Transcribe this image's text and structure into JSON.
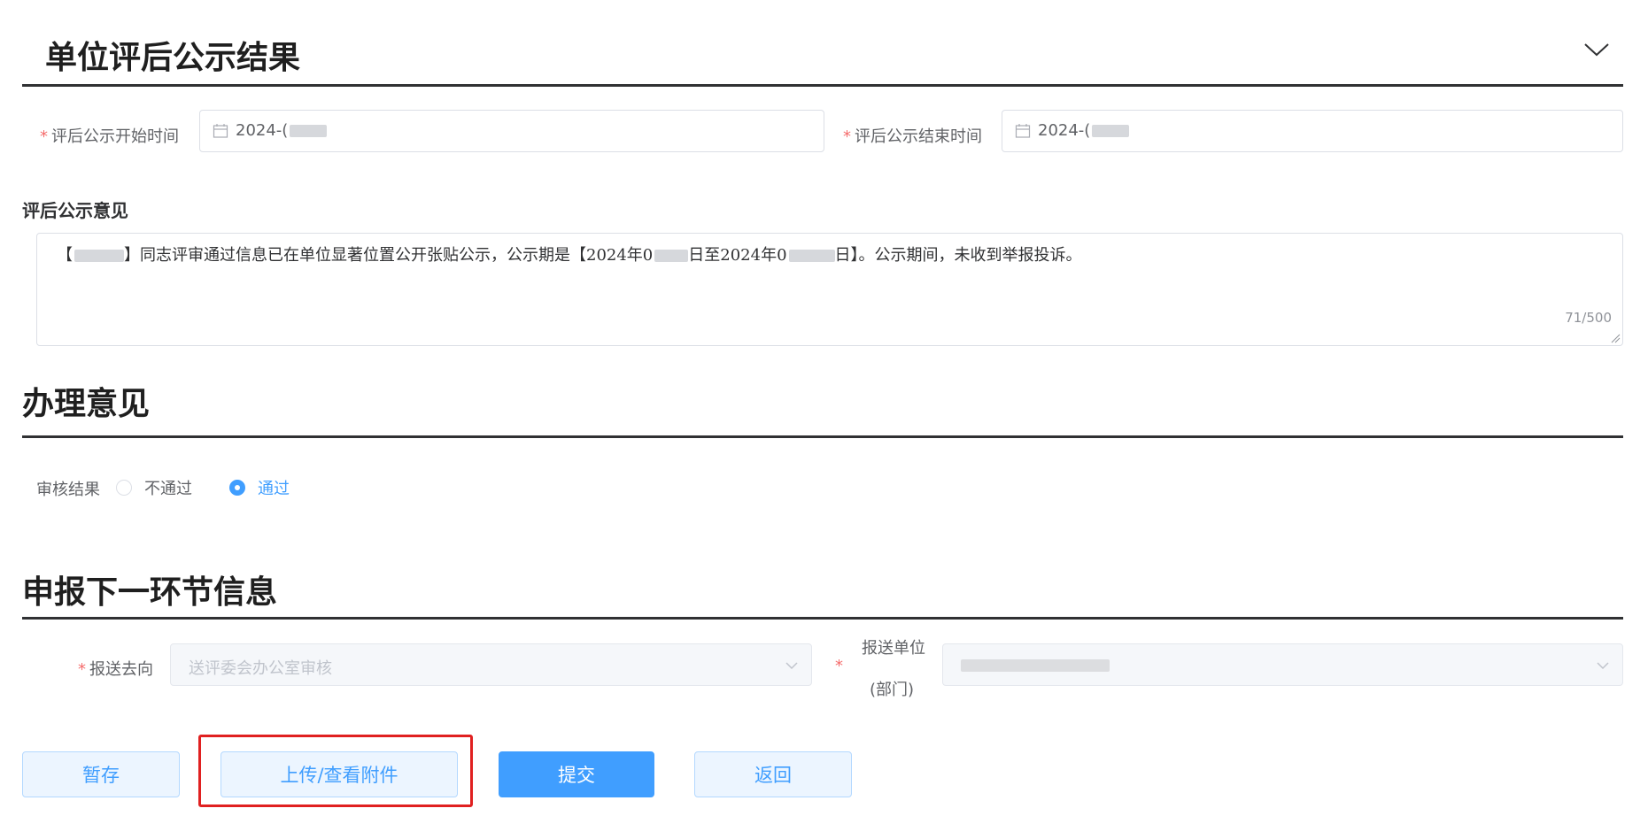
{
  "section1": {
    "title": "单位评后公示结果",
    "start_label": "评后公示开始时间",
    "start_value": "2024-(",
    "end_label": "评后公示结束时间",
    "end_value": "2024-(",
    "opinion_title": "评后公示意见",
    "opinion_text_a": "【",
    "opinion_text_b": "】同志评审通过信息已在单位显著位置公开张贴公示，公示期是【2024年0",
    "opinion_text_c": "日至2024年0",
    "opinion_text_d": "日】。公示期间，未收到举报投诉。",
    "char_count": "71/500"
  },
  "section2": {
    "title": "办理意见",
    "review_label": "审核结果",
    "options": [
      "不通过",
      "通过"
    ],
    "selected": "通过"
  },
  "section3": {
    "title": "申报下一环节信息",
    "direction_label": "报送去向",
    "direction_value": "送评委会办公室审核",
    "unit_label_line1": "报送单位",
    "unit_label_line2": "(部门)"
  },
  "buttons": {
    "save": "暂存",
    "upload": "上传/查看附件",
    "submit": "提交",
    "back": "返回"
  },
  "colors": {
    "primary": "#409eff",
    "required": "#f56c6c",
    "highlight": "#e02020"
  },
  "icons": [
    "chevron-down-icon",
    "calendar-icon",
    "resize-grip-icon",
    "select-arrow-icon"
  ]
}
